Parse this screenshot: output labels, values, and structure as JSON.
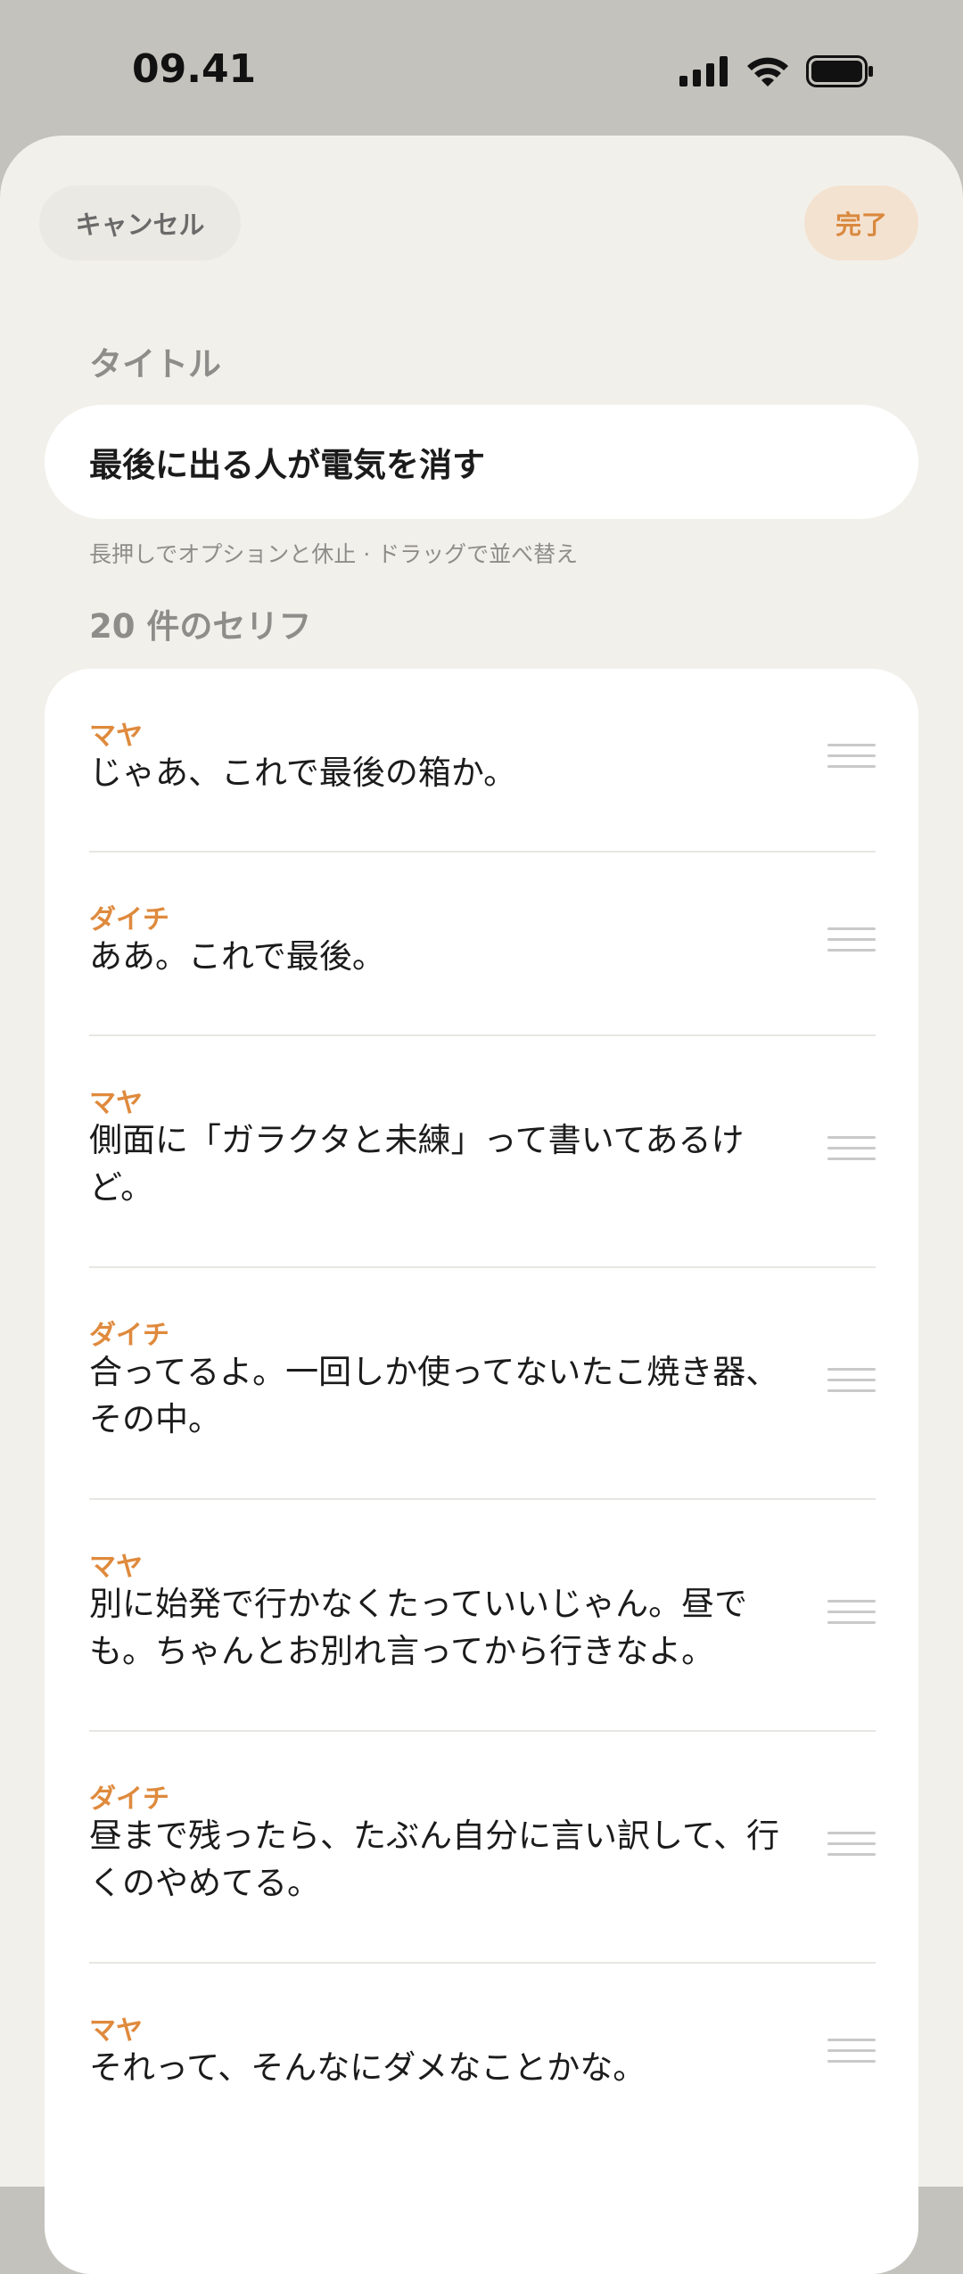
{
  "status": {
    "time": "09.41"
  },
  "header": {
    "cancel_label": "キャンセル",
    "done_label": "完了"
  },
  "title_section": {
    "label": "タイトル",
    "value": "最後に出る人が電気を消す"
  },
  "hint": "長押しでオプションと休止 · ドラッグで並べ替え",
  "lines_section": {
    "count_label": "20 件のセリフ"
  },
  "lines": [
    {
      "speaker": "マヤ",
      "text": "じゃあ、これで最後の箱か。"
    },
    {
      "speaker": "ダイチ",
      "text": "ああ。これで最後。"
    },
    {
      "speaker": "マヤ",
      "text": "側面に「ガラクタと未練」って書いてあるけど。"
    },
    {
      "speaker": "ダイチ",
      "text": "合ってるよ。一回しか使ってないたこ焼き器、その中。"
    },
    {
      "speaker": "マヤ",
      "text": "別に始発で行かなくたっていいじゃん。昼でも。ちゃんとお別れ言ってから行きなよ。"
    },
    {
      "speaker": "ダイチ",
      "text": "昼まで残ったら、たぶん自分に言い訳して、行くのやめてる。"
    },
    {
      "speaker": "マヤ",
      "text": "それって、そんなにダメなことかな。"
    }
  ],
  "colors": {
    "accent": "#df8a3d",
    "sheet_bg": "#f2f0eb",
    "top_bg": "#c3c2bc"
  }
}
